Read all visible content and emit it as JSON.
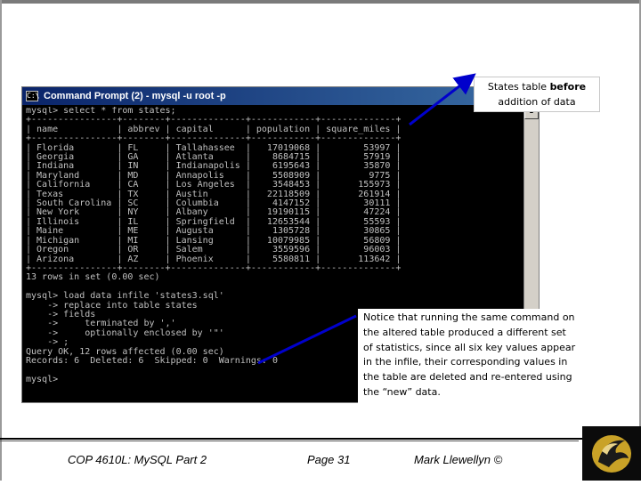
{
  "window": {
    "title": "Command Prompt (2) - mysql -u root -p",
    "icon_text": "C:\\"
  },
  "console_lines": [
    "mysql> select * from states;",
    "+----------------+--------+--------------+------------+--------------+",
    "| name           | abbrev | capital      | population | square_miles |",
    "+----------------+--------+--------------+------------+--------------+",
    "| Florida        | FL     | Tallahassee  |   17019068 |        53997 |",
    "| Georgia        | GA     | Atlanta      |    8684715 |        57919 |",
    "| Indiana        | IN     | Indianapolis |    6195643 |        35870 |",
    "| Maryland       | MD     | Annapolis    |    5508909 |         9775 |",
    "| California     | CA     | Los Angeles  |    3548453 |       155973 |",
    "| Texas          | TX     | Austin       |   22118509 |       261914 |",
    "| South Carolina | SC     | Columbia     |    4147152 |        30111 |",
    "| New York       | NY     | Albany       |   19190115 |        47224 |",
    "| Illinois       | IL     | Springfield  |   12653544 |        55593 |",
    "| Maine          | ME     | Augusta      |    1305728 |        30865 |",
    "| Michigan       | MI     | Lansing      |   10079985 |        56809 |",
    "| Oregon         | OR     | Salem        |    3559596 |        96003 |",
    "| Arizona        | AZ     | Phoenix      |    5580811 |       113642 |",
    "+----------------+--------+--------------+------------+--------------+",
    "13 rows in set (0.00 sec)",
    "",
    "mysql> load data infile 'states3.sql'",
    "    -> replace into table states",
    "    -> fields",
    "    ->     terminated by ','",
    "    ->     optionally enclosed by '\"'",
    "    -> ;",
    "Query OK, 12 rows affected (0.00 sec)",
    "Records: 6  Deleted: 6  Skipped: 0  Warnings: 0",
    "",
    "mysql>"
  ],
  "callouts": {
    "top_plain": "States table ",
    "top_bold": "before",
    "top_line2": "addition of data",
    "bottom": [
      "Notice that running the same command on",
      "the altered table produced a different set",
      "of statistics, since all six key values appear",
      "in the infile, their corresponding values in",
      "the table are deleted and re-entered using",
      "the “new” data."
    ]
  },
  "footer": {
    "course": "COP 4610L: MySQL Part 2",
    "page": "Page 31",
    "author": "Mark Llewellyn ©"
  },
  "colors": {
    "console_bg": "#000000",
    "console_text": "#c0c0c0",
    "titlebar": "#0a246a",
    "arrow": "#0000cc"
  }
}
